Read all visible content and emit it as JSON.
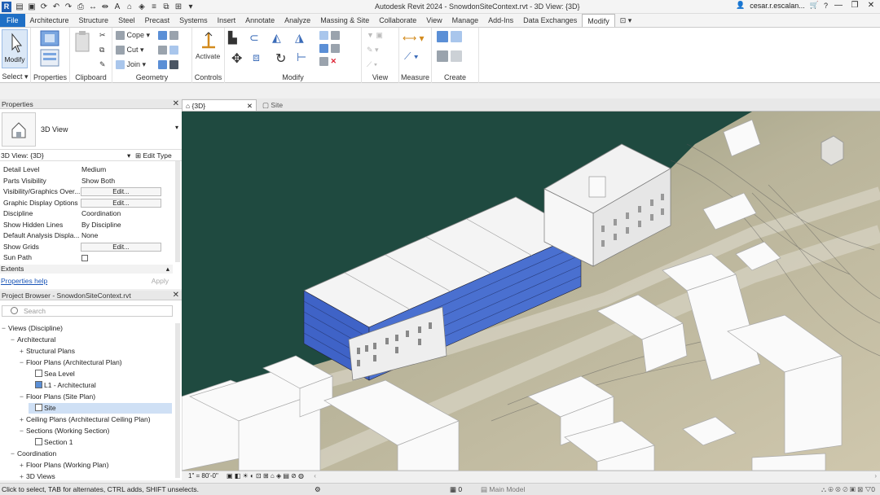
{
  "titlebar": {
    "title": "Autodesk Revit 2024 - SnowdonSiteContext.rvt - 3D View: {3D}",
    "user": "cesar.r.escalan...",
    "help": "?"
  },
  "tabs": [
    "File",
    "Architecture",
    "Structure",
    "Steel",
    "Precast",
    "Systems",
    "Insert",
    "Annotate",
    "Analyze",
    "Massing & Site",
    "Collaborate",
    "View",
    "Manage",
    "Add-Ins",
    "Data Exchanges",
    "Modify"
  ],
  "ribbon": {
    "select": {
      "button": "Modify",
      "label": "Select"
    },
    "properties": {
      "label": "Properties"
    },
    "clipboard": {
      "label": "Clipboard",
      "cope": "Cope",
      "cut": "Cut",
      "join": "Join"
    },
    "geometry": {
      "label": "Geometry"
    },
    "controls": {
      "label": "Controls",
      "activate": "Activate"
    },
    "modify": {
      "label": "Modify"
    },
    "view": {
      "label": "View"
    },
    "measure": {
      "label": "Measure"
    },
    "create": {
      "label": "Create"
    }
  },
  "properties": {
    "title": "Properties",
    "type_name": "3D View",
    "instance": "3D View: {3D}",
    "edit_type": "Edit Type",
    "params": [
      {
        "name": "Detail Level",
        "value": "Medium"
      },
      {
        "name": "Parts Visibility",
        "value": "Show Both"
      },
      {
        "name": "Visibility/Graphics Over...",
        "button": "Edit..."
      },
      {
        "name": "Graphic Display Options",
        "button": "Edit..."
      },
      {
        "name": "Discipline",
        "value": "Coordination"
      },
      {
        "name": "Show Hidden Lines",
        "value": "By Discipline"
      },
      {
        "name": "Default Analysis Displa...",
        "value": "None"
      },
      {
        "name": "Show Grids",
        "button": "Edit..."
      },
      {
        "name": "Sun Path",
        "checkbox": true
      }
    ],
    "group": "Extents",
    "help": "Properties help",
    "apply": "Apply"
  },
  "browser": {
    "title": "Project Browser - SnowdonSiteContext.rvt",
    "search_placeholder": "Search",
    "items": [
      {
        "label": "Views (Discipline)",
        "level": 0,
        "toggle": "−"
      },
      {
        "label": "Architectural",
        "level": 1,
        "toggle": "−"
      },
      {
        "label": "Structural Plans",
        "level": 2,
        "toggle": "+"
      },
      {
        "label": "Floor Plans (Architectural Plan)",
        "level": 2,
        "toggle": "−"
      },
      {
        "label": "Sea Level",
        "level": 3,
        "view": true
      },
      {
        "label": "L1 - Architectural",
        "level": 3,
        "view": true,
        "blue": true
      },
      {
        "label": "Floor Plans (Site Plan)",
        "level": 2,
        "toggle": "−"
      },
      {
        "label": "Site",
        "level": 3,
        "view": true,
        "selected": true
      },
      {
        "label": "Ceiling Plans (Architectural Ceiling Plan)",
        "level": 2,
        "toggle": "+"
      },
      {
        "label": "Sections (Working Section)",
        "level": 2,
        "toggle": "−"
      },
      {
        "label": "Section 1",
        "level": 3,
        "view": true
      },
      {
        "label": "Coordination",
        "level": 1,
        "toggle": "−"
      },
      {
        "label": "Floor Plans (Working Plan)",
        "level": 2,
        "toggle": "+"
      },
      {
        "label": "3D Views",
        "level": 2,
        "toggle": "+"
      }
    ]
  },
  "view_tabs": [
    {
      "label": "{3D}",
      "active": true
    },
    {
      "label": "Site",
      "active": false
    }
  ],
  "view_control": {
    "scale": "1\" = 80'-0\""
  },
  "status": {
    "message": "Click to select, TAB for alternates, CTRL adds, SHIFT unselects.",
    "worksets_count": "0",
    "model": "Main Model",
    "filter_count": "0"
  },
  "colors": {
    "water": "#1f4a40",
    "building_blue": "#3f63c7",
    "accent": "#1f6fc5"
  }
}
